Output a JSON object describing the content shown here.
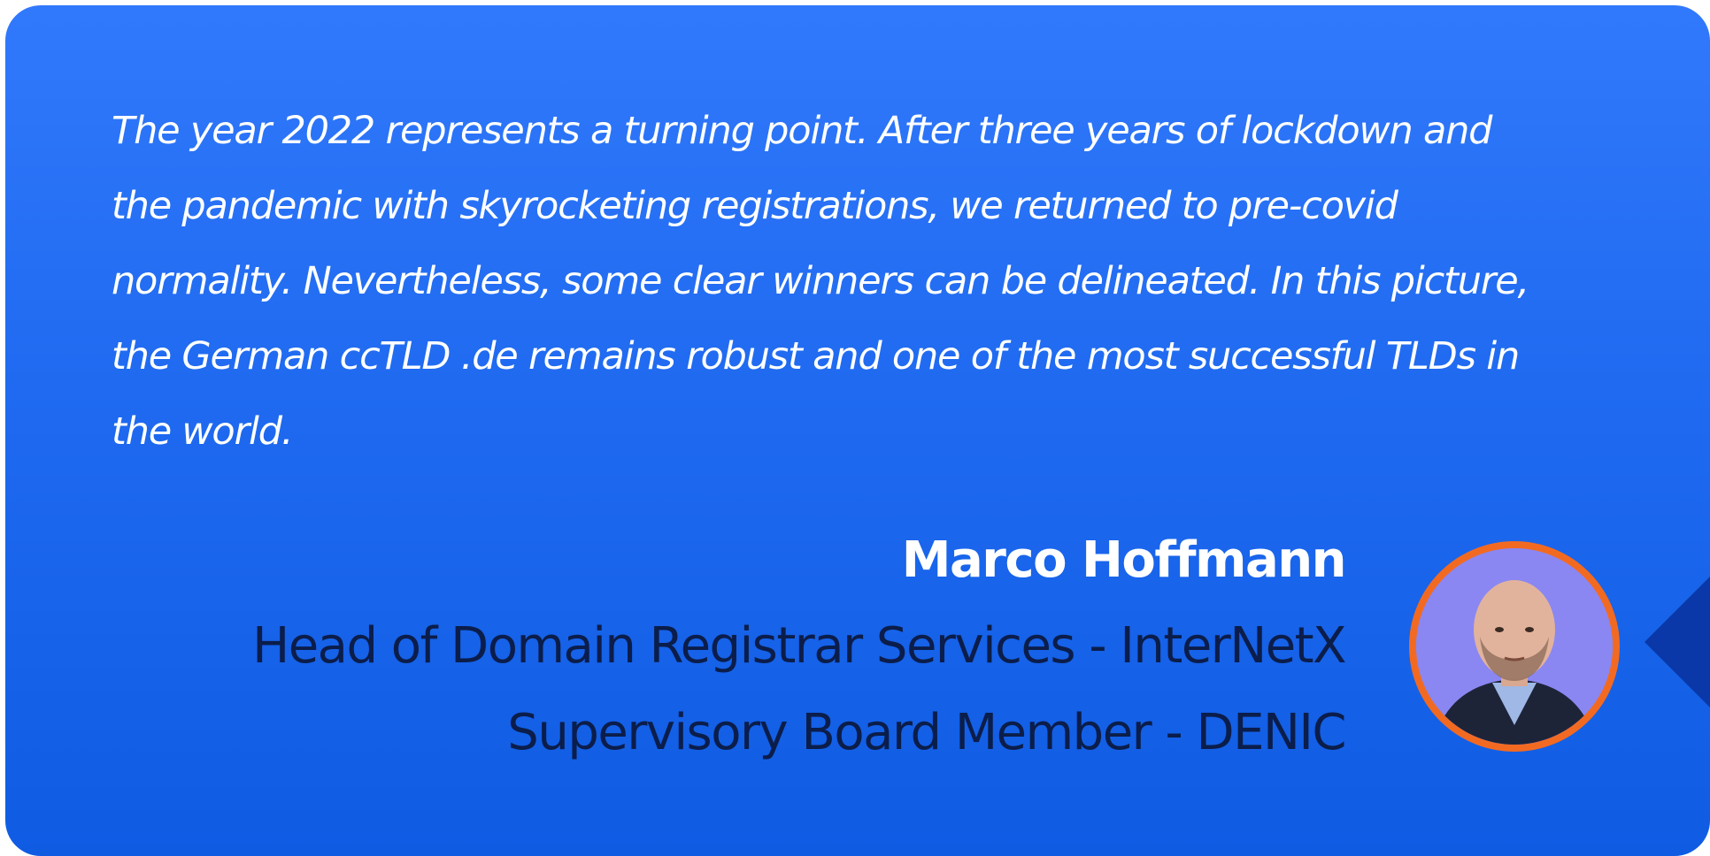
{
  "quote": {
    "lines": [
      "The year 2022 represents a turning point. After three years of lockdown and",
      "the pandemic with skyrocketing registrations, we returned to pre-covid",
      "normality. Nevertheless, some clear winners can be delineated. In this picture,",
      "the German ccTLD .de remains robust and one of the most successful TLDs in",
      "the world."
    ]
  },
  "author": {
    "name": "Marco Hoffmann",
    "roles": [
      "Head of Domain Registrar Services - InterNetX",
      "Supervisory Board Member - DENIC"
    ],
    "avatar_icon": "person-portrait-icon"
  },
  "colors": {
    "card_gradient_top": "#3179fc",
    "card_gradient_bottom": "#0f5ce3",
    "quote_text": "#ffffff",
    "name_text": "#ffffff",
    "role_text": "#0b1d4a",
    "avatar_border": "#f26a21",
    "avatar_background": "#8a87f2",
    "pointer": "#0a38a8"
  }
}
